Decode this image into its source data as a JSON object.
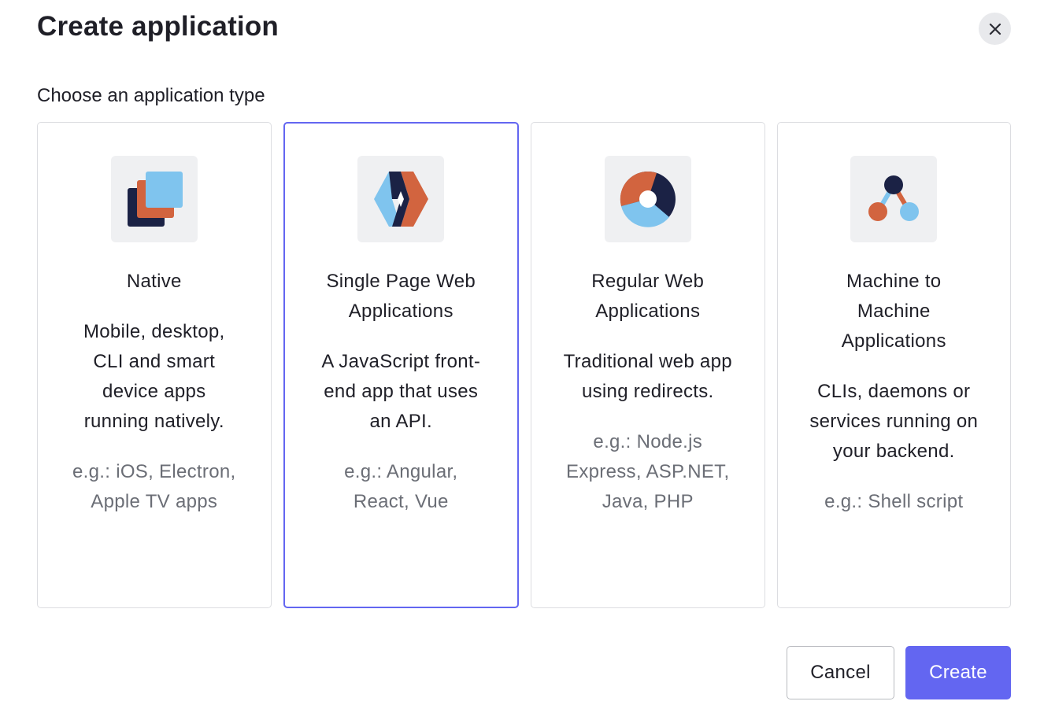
{
  "dialog": {
    "title": "Create application",
    "subtitle": "Choose an application type"
  },
  "cards": [
    {
      "title": "Native",
      "description": "Mobile, desktop, CLI and smart device apps running natively.",
      "example": "e.g.: iOS, Electron, Apple TV apps",
      "icon": "native-app-icon",
      "selected": false
    },
    {
      "title": "Single Page Web Applications",
      "description": "A JavaScript front-end app that uses an API.",
      "example": "e.g.: Angular, React, Vue",
      "icon": "spa-icon",
      "selected": true
    },
    {
      "title": "Regular Web Applications",
      "description": "Traditional web app using redirects.",
      "example": "e.g.: Node.js Express, ASP.NET, Java, PHP",
      "icon": "regular-web-app-icon",
      "selected": false
    },
    {
      "title": "Machine to Machine Applications",
      "description": "CLIs, daemons or services running on your backend.",
      "example": "e.g.: Shell script",
      "icon": "machine-to-machine-icon",
      "selected": false
    }
  ],
  "footer": {
    "cancel_label": "Cancel",
    "create_label": "Create"
  },
  "colors": {
    "accent": "#6366f1",
    "dark_navy": "#1b2245",
    "orange": "#d2643f",
    "light_blue": "#7fc4ee",
    "tile_bg": "#eff0f2"
  }
}
